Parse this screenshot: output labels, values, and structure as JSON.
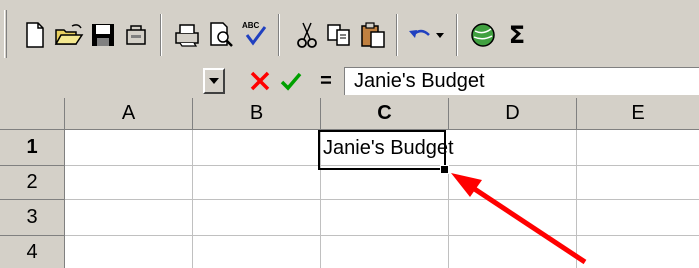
{
  "toolbar": {
    "buttons": [
      {
        "name": "new-icon"
      },
      {
        "name": "open-icon"
      },
      {
        "name": "save-icon"
      },
      {
        "name": "email-icon"
      },
      {
        "name": "print-icon"
      },
      {
        "name": "print-preview-icon"
      },
      {
        "name": "spelling-icon",
        "label": "ABC"
      },
      {
        "name": "cut-icon"
      },
      {
        "name": "copy-icon"
      },
      {
        "name": "paste-icon"
      },
      {
        "name": "undo-icon"
      },
      {
        "name": "web-icon"
      },
      {
        "name": "autosum-icon",
        "label": "Σ"
      }
    ]
  },
  "formula_bar": {
    "equals_label": "=",
    "content": "Janie's Budget"
  },
  "grid": {
    "columns": [
      "A",
      "B",
      "C",
      "D",
      "E"
    ],
    "rows": [
      "1",
      "2",
      "3",
      "4"
    ],
    "active_cell": "C1",
    "cells": {
      "C1": "Janie's Budget"
    }
  },
  "colors": {
    "toolbar_bg": "#d4d0c8",
    "arrow": "#ff0000",
    "cancel_x": "#ff0000",
    "enter_check": "#00a000"
  }
}
